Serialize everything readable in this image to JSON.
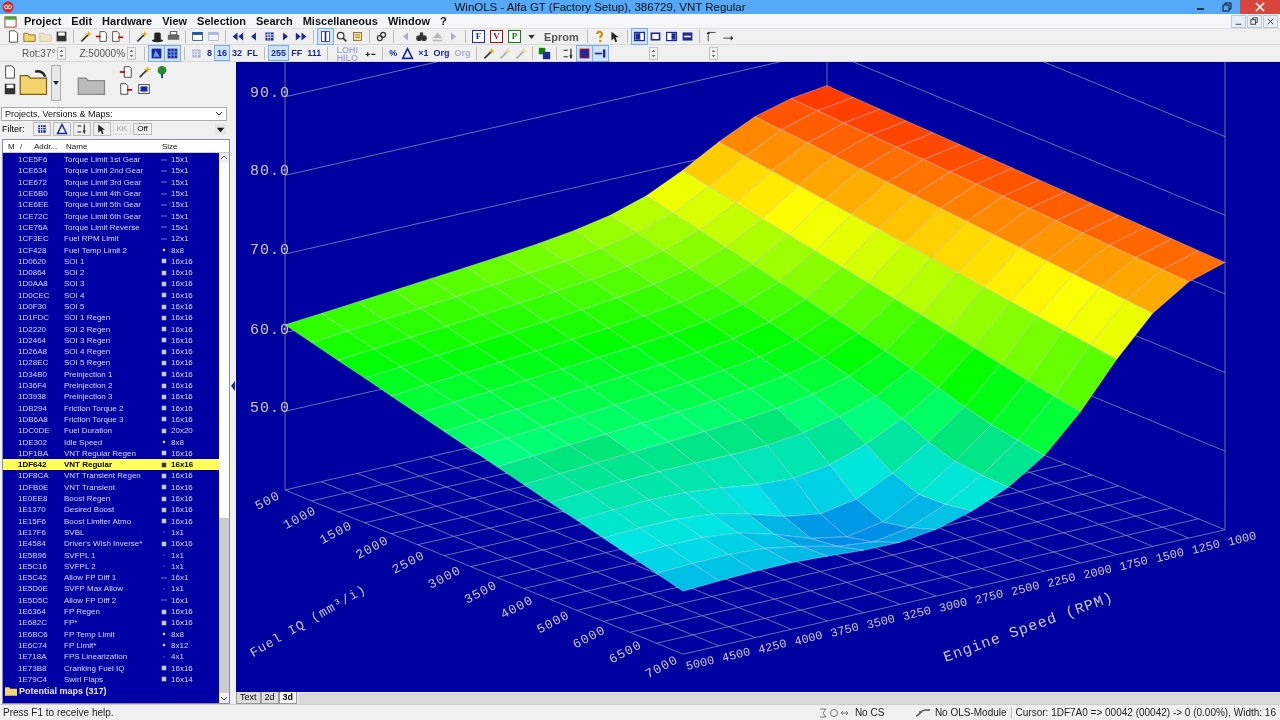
{
  "window": {
    "title": "WinOLS - Alfa GT (Factory Setup), 386729, VNT Regular"
  },
  "menu": [
    "Project",
    "Edit",
    "Hardware",
    "View",
    "Selection",
    "Search",
    "Miscellaneous",
    "Window",
    "?"
  ],
  "toolbar_1": [
    {
      "kind": "icon",
      "pressed": false,
      "disabled": false
    },
    {
      "kind": "icon",
      "pressed": false,
      "disabled": false
    },
    {
      "kind": "icon",
      "pressed": false,
      "disabled": true
    },
    {
      "kind": "icon",
      "pressed": false,
      "disabled": false
    },
    {
      "kind": "separator"
    },
    {
      "kind": "icon",
      "pressed": false,
      "disabled": false
    },
    {
      "kind": "icon",
      "pressed": false,
      "disabled": false
    },
    {
      "kind": "icon",
      "pressed": false,
      "disabled": false
    },
    {
      "kind": "separator"
    },
    {
      "kind": "icon",
      "pressed": false,
      "disabled": false
    },
    {
      "kind": "icon",
      "pressed": false,
      "disabled": false
    },
    {
      "kind": "icon",
      "pressed": false,
      "disabled": false
    },
    {
      "kind": "separator"
    },
    {
      "kind": "icon",
      "pressed": false,
      "disabled": false
    },
    {
      "kind": "icon",
      "pressed": false,
      "disabled": true
    },
    {
      "kind": "separator"
    },
    {
      "kind": "icon",
      "pressed": false,
      "disabled": false
    },
    {
      "kind": "icon",
      "pressed": false,
      "disabled": false
    },
    {
      "kind": "icon",
      "pressed": false,
      "disabled": false
    },
    {
      "kind": "icon",
      "pressed": false,
      "disabled": false
    },
    {
      "kind": "icon",
      "pressed": false,
      "disabled": false
    },
    {
      "kind": "separator"
    },
    {
      "kind": "icon",
      "pressed": true,
      "disabled": false
    },
    {
      "kind": "icon",
      "pressed": false,
      "disabled": false
    },
    {
      "kind": "icon",
      "pressed": false,
      "disabled": false
    },
    {
      "kind": "separator"
    },
    {
      "kind": "icon",
      "pressed": false,
      "disabled": false
    },
    {
      "kind": "separator"
    },
    {
      "kind": "icon",
      "pressed": false,
      "disabled": true
    },
    {
      "kind": "icon",
      "pressed": false,
      "disabled": false
    },
    {
      "kind": "icon",
      "pressed": false,
      "disabled": true
    },
    {
      "kind": "icon",
      "pressed": false,
      "disabled": true
    },
    {
      "kind": "separator"
    },
    {
      "kind": "letter",
      "label": "F",
      "color": "#1a2a9a",
      "pressed": false,
      "disabled": false
    },
    {
      "kind": "letter",
      "label": "V",
      "color": "#b01010",
      "pressed": false,
      "disabled": false
    },
    {
      "kind": "letter",
      "label": "P",
      "color": "#108010",
      "pressed": false,
      "disabled": false
    },
    {
      "kind": "icon",
      "pressed": false,
      "disabled": false
    },
    {
      "kind": "text",
      "label": "Eprom",
      "pressed": false,
      "disabled": false
    },
    {
      "kind": "separator"
    },
    {
      "kind": "icon",
      "pressed": false,
      "disabled": false
    },
    {
      "kind": "icon",
      "pressed": false,
      "disabled": false
    },
    {
      "kind": "separator"
    },
    {
      "kind": "icon",
      "pressed": true,
      "disabled": false
    },
    {
      "kind": "icon",
      "pressed": false,
      "disabled": false
    },
    {
      "kind": "icon",
      "pressed": false,
      "disabled": false
    },
    {
      "kind": "icon",
      "pressed": false,
      "disabled": false
    },
    {
      "kind": "separator"
    },
    {
      "kind": "icon",
      "pressed": false,
      "disabled": false
    },
    {
      "kind": "icon",
      "pressed": false,
      "disabled": false
    }
  ],
  "toolbar_2": [
    {
      "kind": "spinner",
      "label": "Rot:37°"
    },
    {
      "kind": "spinner",
      "label": "Z:50000%"
    },
    {
      "kind": "separator"
    },
    {
      "kind": "icon",
      "pressed": true,
      "disabled": false
    },
    {
      "kind": "icon",
      "pressed": true,
      "disabled": false
    },
    {
      "kind": "separator"
    },
    {
      "kind": "icon",
      "pressed": false,
      "disabled": true
    },
    {
      "kind": "text",
      "label": "8",
      "pressed": false,
      "disabled": false
    },
    {
      "kind": "text",
      "label": "16",
      "pressed": true,
      "disabled": false
    },
    {
      "kind": "text",
      "label": "32",
      "pressed": false,
      "disabled": false
    },
    {
      "kind": "text",
      "label": "FL",
      "pressed": false,
      "disabled": false
    },
    {
      "kind": "separator"
    },
    {
      "kind": "text",
      "label": "255",
      "pressed": true,
      "disabled": false
    },
    {
      "kind": "text",
      "label": "FF",
      "pressed": false,
      "disabled": false
    },
    {
      "kind": "text",
      "label": "111",
      "pressed": false,
      "disabled": false
    },
    {
      "kind": "separator"
    },
    {
      "kind": "text",
      "label": "LOHI HILO",
      "pressed": false,
      "disabled": true
    },
    {
      "kind": "icon",
      "pressed": false,
      "disabled": false
    },
    {
      "kind": "separator"
    },
    {
      "kind": "text",
      "label": "%",
      "pressed": false,
      "disabled": false
    },
    {
      "kind": "icon",
      "pressed": false,
      "disabled": false
    },
    {
      "kind": "text",
      "label": "×1",
      "pressed": false,
      "disabled": false
    },
    {
      "kind": "text",
      "label": "Org",
      "pressed": false,
      "disabled": false
    },
    {
      "kind": "text",
      "label": "Org",
      "pressed": false,
      "disabled": true
    },
    {
      "kind": "separator"
    },
    {
      "kind": "icon",
      "pressed": false,
      "disabled": false
    },
    {
      "kind": "icon",
      "pressed": false,
      "disabled": true
    },
    {
      "kind": "icon",
      "pressed": false,
      "disabled": true
    },
    {
      "kind": "separator"
    },
    {
      "kind": "icon",
      "pressed": false,
      "disabled": false
    },
    {
      "kind": "separator"
    },
    {
      "kind": "icon",
      "pressed": false,
      "disabled": false
    },
    {
      "kind": "icon",
      "pressed": true,
      "disabled": false
    },
    {
      "kind": "icon",
      "pressed": true,
      "disabled": false
    }
  ],
  "sidebar": {
    "source": {
      "value": "Projects, Versions & Maps:"
    },
    "filter": {
      "label": "Filter:",
      "buttons": [
        {
          "kind": "icon",
          "disabled": false
        },
        {
          "kind": "icon",
          "disabled": false
        },
        {
          "kind": "icon",
          "disabled": false
        },
        {
          "kind": "icon",
          "disabled": false
        },
        {
          "kind": "text",
          "label": "KK",
          "disabled": true
        },
        {
          "kind": "text",
          "label": "Off",
          "disabled": false
        }
      ]
    },
    "columns": [
      "M",
      "/",
      "Addr...",
      "Name",
      "Size"
    ],
    "maps": [
      {
        "address": "1CE5F6",
        "name": "Torque Limit 1st Gear",
        "kind": "curve",
        "size": "15x1",
        "selected": false
      },
      {
        "address": "1CE634",
        "name": "Torque Limit 2nd Gear",
        "kind": "curve",
        "size": "15x1",
        "selected": false
      },
      {
        "address": "1CE672",
        "name": "Torque Limit 3rd Gear",
        "kind": "curve",
        "size": "15x1",
        "selected": false
      },
      {
        "address": "1CE6B0",
        "name": "Torque Limit 4th Gear",
        "kind": "curve",
        "size": "15x1",
        "selected": false
      },
      {
        "address": "1CE6EE",
        "name": "Torque Limit 5th Gear",
        "kind": "curve",
        "size": "15x1",
        "selected": false
      },
      {
        "address": "1CE72C",
        "name": "Torque Limit 6th Gear",
        "kind": "curve",
        "size": "15x1",
        "selected": false
      },
      {
        "address": "1CE76A",
        "name": "Torque Limit Reverse",
        "kind": "curve",
        "size": "15x1",
        "selected": false
      },
      {
        "address": "1CF3EC",
        "name": "Fuel RPM Limit",
        "kind": "curve",
        "size": "12x1",
        "selected": false
      },
      {
        "address": "1CF428",
        "name": "Fuel Temp Limit 2",
        "kind": "small",
        "size": "8x8",
        "selected": false
      },
      {
        "address": "1D0620",
        "name": "SOI 1",
        "kind": "map",
        "size": "16x16",
        "selected": false
      },
      {
        "address": "1D0864",
        "name": "SOI 2",
        "kind": "map",
        "size": "16x16",
        "selected": false
      },
      {
        "address": "1D0AA8",
        "name": "SOI 3",
        "kind": "map",
        "size": "16x16",
        "selected": false
      },
      {
        "address": "1D0CEC",
        "name": "SOI 4",
        "kind": "map",
        "size": "16x16",
        "selected": false
      },
      {
        "address": "1D0F30",
        "name": "SOI 5",
        "kind": "map",
        "size": "16x16",
        "selected": false
      },
      {
        "address": "1D1FDC",
        "name": "SOI 1 Regen",
        "kind": "map",
        "size": "16x16",
        "selected": false
      },
      {
        "address": "1D2220",
        "name": "SOI 2 Regen",
        "kind": "map",
        "size": "16x16",
        "selected": false
      },
      {
        "address": "1D2464",
        "name": "SOI 3 Regen",
        "kind": "map",
        "size": "16x16",
        "selected": false
      },
      {
        "address": "1D26A8",
        "name": "SOI 4 Regen",
        "kind": "map",
        "size": "16x16",
        "selected": false
      },
      {
        "address": "1D28EC",
        "name": "SOI 5 Regen",
        "kind": "map",
        "size": "16x16",
        "selected": false
      },
      {
        "address": "1D34B0",
        "name": "Preinjection 1",
        "kind": "map",
        "size": "16x16",
        "selected": false
      },
      {
        "address": "1D36F4",
        "name": "Preinjection 2",
        "kind": "map",
        "size": "16x16",
        "selected": false
      },
      {
        "address": "1D3938",
        "name": "Preinjection 3",
        "kind": "map",
        "size": "16x16",
        "selected": false
      },
      {
        "address": "1DB294",
        "name": "Friction Torque 2",
        "kind": "map",
        "size": "16x16",
        "selected": false
      },
      {
        "address": "1DB6A8",
        "name": "Friction Torque 3",
        "kind": "map",
        "size": "16x16",
        "selected": false
      },
      {
        "address": "1DC0DE",
        "name": "Fuel Duration",
        "kind": "map",
        "size": "20x20",
        "selected": false
      },
      {
        "address": "1DE302",
        "name": "Idle Speed",
        "kind": "small",
        "size": "8x8",
        "selected": false
      },
      {
        "address": "1DF1BA",
        "name": "VNT Regular Regen",
        "kind": "map",
        "size": "16x16",
        "selected": false
      },
      {
        "address": "1DF642",
        "name": "VNT Regular",
        "kind": "map",
        "size": "16x16",
        "selected": true
      },
      {
        "address": "1DF8CA",
        "name": "VNT Transient Regen",
        "kind": "map",
        "size": "16x16",
        "selected": false
      },
      {
        "address": "1DFB0E",
        "name": "VNT Transient",
        "kind": "map",
        "size": "16x16",
        "selected": false
      },
      {
        "address": "1E0EE8",
        "name": "Boost Regen",
        "kind": "map",
        "size": "16x16",
        "selected": false
      },
      {
        "address": "1E1370",
        "name": "Desired Boost",
        "kind": "map",
        "size": "16x16",
        "selected": false
      },
      {
        "address": "1E15F6",
        "name": "Boost Limiter Atmo",
        "kind": "map",
        "size": "16x16",
        "selected": false
      },
      {
        "address": "1E17F6",
        "name": "SVBL",
        "kind": "value",
        "size": "1x1",
        "selected": false
      },
      {
        "address": "1E4584",
        "name": "Driver's Wish Inverse*",
        "kind": "map",
        "size": "16x16",
        "selected": false
      },
      {
        "address": "1E5B96",
        "name": "SVFPL 1",
        "kind": "value",
        "size": "1x1",
        "selected": false
      },
      {
        "address": "1E5C16",
        "name": "SVFPL 2",
        "kind": "value",
        "size": "1x1",
        "selected": false
      },
      {
        "address": "1E5C42",
        "name": "Allow FP Diff 1",
        "kind": "curve",
        "size": "16x1",
        "selected": false
      },
      {
        "address": "1E5D0E",
        "name": "SVFP Max Allow",
        "kind": "value",
        "size": "1x1",
        "selected": false
      },
      {
        "address": "1E5D5C",
        "name": "Allow FP Diff 2",
        "kind": "curve",
        "size": "16x1",
        "selected": false
      },
      {
        "address": "1E6364",
        "name": "FP Regen",
        "kind": "map",
        "size": "16x16",
        "selected": false
      },
      {
        "address": "1E682C",
        "name": "FP*",
        "kind": "map",
        "size": "16x16",
        "selected": false
      },
      {
        "address": "1E6BC6",
        "name": "FP Temp Limit",
        "kind": "small",
        "size": "8x8",
        "selected": false
      },
      {
        "address": "1E6C74",
        "name": "FP Limit*",
        "kind": "small",
        "size": "8x12",
        "selected": false
      },
      {
        "address": "1E718A",
        "name": "FPS Linearization",
        "kind": "value",
        "size": "4x1",
        "selected": false
      },
      {
        "address": "1E73B8",
        "name": "Cranking Fuel IQ",
        "kind": "map",
        "size": "16x16",
        "selected": false
      },
      {
        "address": "1E79C4",
        "name": "Swirl Flaps",
        "kind": "map",
        "size": "16x14",
        "selected": false
      }
    ],
    "folders": [
      {
        "label": "Potential maps (317)"
      }
    ]
  },
  "plot": {
    "z_ticks": [
      "90.0",
      "80.0",
      "70.0",
      "60.0",
      "50.0"
    ],
    "x_axis": {
      "title": "Fuel IQ (mm³/i)",
      "ticks": [
        "500",
        "1000",
        "1500",
        "2000",
        "2500",
        "3000",
        "3500",
        "4000",
        "5000",
        "6000",
        "6500",
        "7000"
      ]
    },
    "y_axis": {
      "title": "Engine Speed (RPM)",
      "ticks": [
        "5000",
        "4500",
        "4250",
        "4000",
        "3750",
        "3500",
        "3250",
        "3000",
        "2750",
        "2500",
        "2250",
        "2000",
        "1750",
        "1500",
        "1250",
        "1000"
      ]
    }
  },
  "view_tabs": [
    {
      "label": "Text",
      "selected": false
    },
    {
      "label": "2d",
      "selected": false
    },
    {
      "label": "3d",
      "selected": true
    }
  ],
  "status_bar": {
    "help": "Press F1 to receive help.",
    "checksum": "No CS",
    "module": "No OLS-Module",
    "cursor": "Cursor: 1DF7A0 => 00042 (00042) -> 0 (0.00%), Width: 16"
  }
}
